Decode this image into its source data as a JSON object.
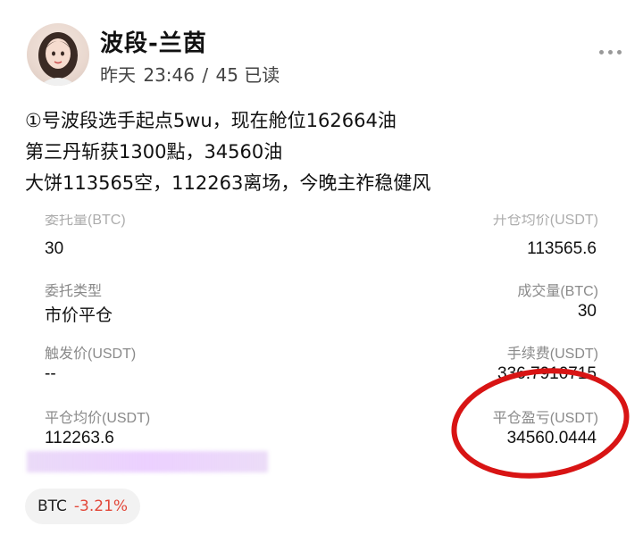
{
  "header": {
    "author_name": "波段-兰茵",
    "day": "昨天",
    "time": "23:46",
    "separator": "/",
    "reads": "45 已读"
  },
  "post": {
    "lines": [
      "①号波段选手起点5wu，现在舱位162664油",
      "第三丹斩获1300點，34560油",
      "大饼113565空，112263离场，今晚主祚稳健风"
    ]
  },
  "order": {
    "top_left_label": "委托量(BTC)",
    "top_left_value": "30",
    "top_right_label": "开仓均价(USDT)",
    "top_right_value": "113565.6",
    "order_type_label": "委托类型",
    "order_type_value": "市价平仓",
    "filled_label": "成交量(BTC)",
    "filled_value": "30",
    "trigger_label": "触发价(USDT)",
    "trigger_value": "--",
    "fee_label": "手续费(USDT)",
    "fee_value": "336.7910715",
    "close_avg_label": "平仓均价(USDT)",
    "close_avg_value": "112263.6",
    "pnl_label": "平仓盈亏(USDT)",
    "pnl_value": "34560.0444"
  },
  "tag": {
    "symbol": "BTC",
    "change": "-3.21%",
    "change_color": "#e2483a"
  },
  "icons": [
    "avatar",
    "more-icon"
  ]
}
